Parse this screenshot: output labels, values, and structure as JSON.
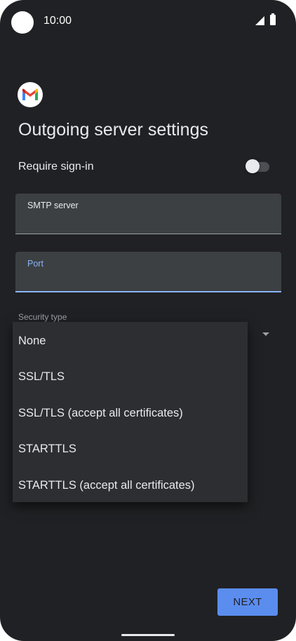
{
  "status_bar": {
    "time": "10:00"
  },
  "page": {
    "title": "Outgoing server settings"
  },
  "require_signin": {
    "label": "Require sign-in",
    "enabled": false
  },
  "smtp_server": {
    "label": "SMTP server",
    "value": ""
  },
  "port": {
    "label": "Port",
    "value": ""
  },
  "security": {
    "label": "Security type",
    "options": [
      "None",
      "SSL/TLS",
      "SSL/TLS (accept all certificates)",
      "STARTTLS",
      "STARTTLS (accept all certificates)"
    ]
  },
  "actions": {
    "next_label": "NEXT"
  },
  "colors": {
    "background": "#202124",
    "accent": "#8ab4f8",
    "button": "#5b8def"
  },
  "icons": [
    "camera-icon",
    "signal-icon",
    "battery-icon",
    "gmail-logo-icon",
    "dropdown-arrow-icon"
  ]
}
